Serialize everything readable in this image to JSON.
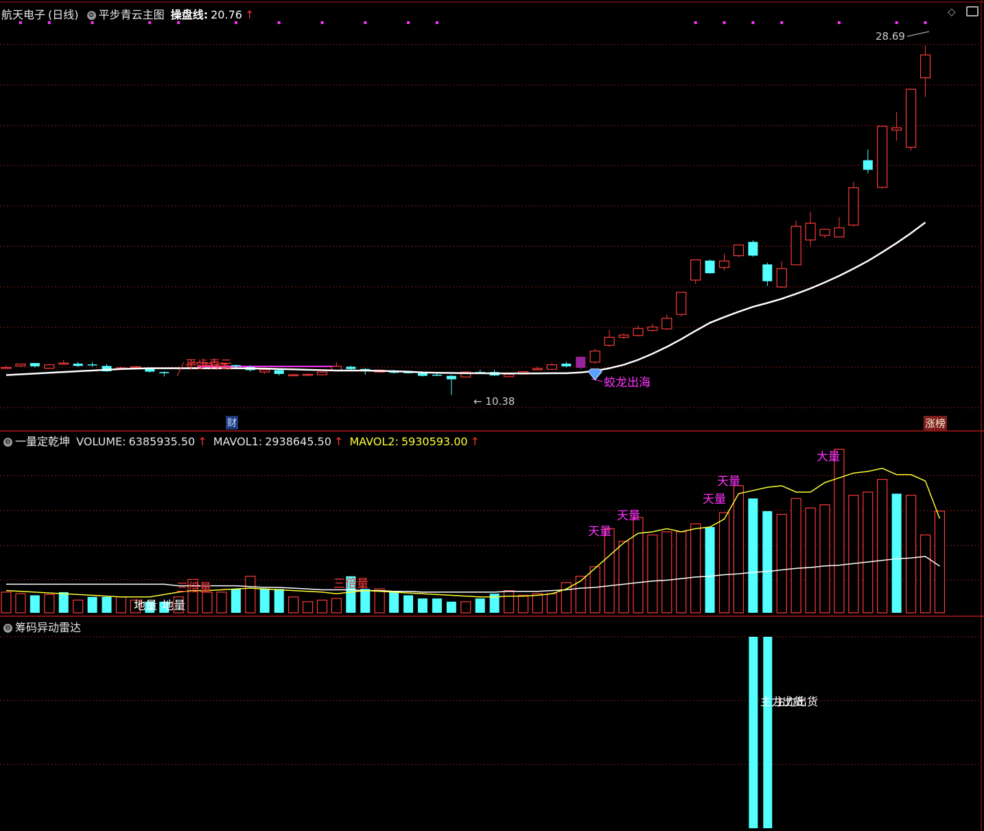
{
  "header": {
    "stock_name": "航天电子",
    "period": "(日线)",
    "main_indicator": "平步青云主图",
    "line_label": "操盘线:",
    "line_value": "20.76",
    "arrow": "↑"
  },
  "volume_header": {
    "name": "一量定乾坤",
    "volume_label": "VOLUME:",
    "volume_value": "6385935.50",
    "mavol1_label": "MAVOL1:",
    "mavol1_value": "2938645.50",
    "mavol2_label": "MAVOL2:",
    "mavol2_value": "5930593.00",
    "arrow": "↑"
  },
  "radar_header": {
    "name": "筹码异动雷达"
  },
  "badges": {
    "cai": "财",
    "zhangbang": "涨榜"
  },
  "icons": [
    "settings-icon",
    "diamond-icon",
    "window-icon"
  ],
  "colors": {
    "up": "#ff3b3b",
    "down": "#54ffff",
    "grid": "#8a1a1a",
    "magenta": "#ff33ff",
    "yellow": "#ffff33",
    "special": "#992299"
  },
  "chart_data": [
    {
      "type": "candlestick",
      "title": "平步青云主图",
      "annotations": [
        {
          "text": "平步青云",
          "color": "red",
          "x": 13
        },
        {
          "text": "蛟龙出海",
          "color": "magenta",
          "x": 41
        },
        {
          "text": "28.69",
          "x": 65
        },
        {
          "text": "10.38",
          "x": 32
        }
      ],
      "ylim": [
        9.5,
        30.0
      ],
      "ohlc": [
        [
          11.8,
          11.92,
          11.78,
          11.82
        ],
        [
          11.9,
          12.02,
          11.86,
          12.0
        ],
        [
          12.05,
          12.05,
          11.82,
          11.88
        ],
        [
          11.78,
          12.0,
          11.76,
          11.96
        ],
        [
          12.04,
          12.22,
          11.98,
          12.05
        ],
        [
          12.02,
          12.1,
          11.85,
          11.9
        ],
        [
          11.98,
          12.1,
          11.86,
          11.95
        ],
        [
          11.9,
          12.0,
          11.58,
          11.62
        ],
        [
          11.78,
          11.86,
          11.74,
          11.8
        ],
        [
          11.82,
          11.88,
          11.76,
          11.86
        ],
        [
          11.76,
          11.82,
          11.56,
          11.6
        ],
        [
          11.58,
          11.62,
          11.35,
          11.52
        ],
        [
          11.76,
          11.86,
          11.7,
          11.8
        ],
        [
          11.82,
          12.14,
          11.8,
          12.06
        ],
        [
          11.92,
          12.04,
          11.88,
          12.02
        ],
        [
          11.9,
          12.1,
          11.86,
          12.0
        ],
        [
          11.94,
          11.98,
          11.82,
          11.88
        ],
        [
          11.84,
          11.92,
          11.6,
          11.68
        ],
        [
          11.58,
          11.72,
          11.48,
          11.7
        ],
        [
          11.68,
          11.72,
          11.4,
          11.48
        ],
        [
          11.4,
          11.48,
          11.36,
          11.44
        ],
        [
          11.42,
          11.5,
          11.38,
          11.46
        ],
        [
          11.44,
          11.62,
          11.42,
          11.58
        ],
        [
          11.64,
          12.1,
          11.62,
          11.88
        ],
        [
          11.86,
          11.9,
          11.7,
          11.74
        ],
        [
          11.74,
          11.78,
          11.44,
          11.7
        ],
        [
          11.58,
          11.72,
          11.56,
          11.68
        ],
        [
          11.64,
          11.7,
          11.5,
          11.54
        ],
        [
          11.58,
          11.62,
          11.5,
          11.52
        ],
        [
          11.52,
          11.56,
          11.34,
          11.38
        ],
        [
          11.44,
          11.5,
          11.38,
          11.42
        ],
        [
          11.38,
          11.42,
          10.38,
          11.2
        ],
        [
          11.32,
          11.62,
          11.3,
          11.58
        ],
        [
          11.58,
          11.7,
          11.48,
          11.52
        ],
        [
          11.58,
          11.7,
          11.38,
          11.4
        ],
        [
          11.34,
          11.48,
          11.3,
          11.46
        ],
        [
          11.48,
          11.62,
          11.44,
          11.6
        ],
        [
          11.7,
          11.86,
          11.68,
          11.76
        ],
        [
          11.72,
          12.06,
          11.7,
          11.96
        ],
        [
          12.02,
          12.12,
          11.82,
          11.88
        ],
        [
          11.8,
          12.4,
          11.7,
          12.38
        ],
        [
          12.1,
          12.8,
          12.0,
          12.68
        ],
        [
          12.98,
          13.8,
          12.9,
          13.4
        ],
        [
          13.4,
          13.6,
          13.3,
          13.52
        ],
        [
          13.5,
          14.0,
          13.44,
          13.86
        ],
        [
          13.76,
          14.1,
          13.7,
          13.94
        ],
        [
          13.84,
          14.6,
          13.8,
          14.4
        ],
        [
          14.6,
          15.7,
          14.5,
          15.76
        ],
        [
          16.4,
          17.48,
          16.2,
          17.46
        ],
        [
          17.42,
          17.48,
          16.74,
          16.76
        ],
        [
          17.06,
          17.8,
          16.9,
          17.4
        ],
        [
          17.68,
          18.26,
          17.6,
          18.24
        ],
        [
          18.4,
          18.48,
          17.62,
          17.68
        ],
        [
          17.22,
          17.32,
          16.08,
          16.34
        ],
        [
          16.04,
          17.4,
          15.98,
          17.0
        ],
        [
          17.2,
          19.52,
          17.18,
          19.22
        ],
        [
          18.5,
          19.98,
          18.2,
          19.38
        ],
        [
          18.74,
          19.1,
          18.6,
          19.06
        ],
        [
          18.66,
          19.7,
          18.64,
          19.14
        ],
        [
          19.28,
          21.54,
          19.2,
          21.24
        ],
        [
          22.68,
          23.24,
          22.0,
          22.18
        ],
        [
          21.26,
          24.46,
          21.2,
          24.46
        ],
        [
          24.26,
          25.2,
          23.7,
          24.38
        ],
        [
          23.36,
          26.44,
          23.2,
          26.4
        ],
        [
          27.0,
          28.69,
          26.0,
          28.2
        ]
      ],
      "ma_line": [
        11.42,
        11.46,
        11.5,
        11.54,
        11.58,
        11.62,
        11.66,
        11.7,
        11.74,
        11.76,
        11.78,
        11.78,
        11.78,
        11.78,
        11.78,
        11.78,
        11.78,
        11.77,
        11.76,
        11.74,
        11.72,
        11.7,
        11.68,
        11.66,
        11.66,
        11.66,
        11.64,
        11.62,
        11.6,
        11.56,
        11.54,
        11.53,
        11.52,
        11.52,
        11.51,
        11.51,
        11.51,
        11.51,
        11.52,
        11.52,
        11.56,
        11.64,
        11.78,
        11.96,
        12.22,
        12.54,
        12.9,
        13.3,
        13.74,
        14.16,
        14.46,
        14.74,
        15.0,
        15.2,
        15.42,
        15.68,
        15.96,
        16.28,
        16.62,
        17.0,
        17.4,
        17.86,
        18.34,
        18.86,
        19.42
      ]
    },
    {
      "type": "bar",
      "title": "一量定乾坤",
      "series_labels": [
        "VOLUME",
        "MAVOL1",
        "MAVOL2"
      ],
      "labels": [
        {
          "text": "地量",
          "x": 10
        },
        {
          "text": "地量",
          "x": 11
        },
        {
          "text": "三倍量",
          "x": 13
        },
        {
          "text": "三倍量",
          "x": 24
        },
        {
          "text": "天量",
          "x": 42
        },
        {
          "text": "天量",
          "x": 44
        },
        {
          "text": "天量",
          "x": 50
        },
        {
          "text": "天量",
          "x": 51
        },
        {
          "text": "大量",
          "x": 58
        }
      ],
      "ylim": [
        0,
        10500000
      ],
      "volume": [
        1300000,
        1200000,
        1100000,
        1150000,
        1300000,
        800000,
        1000000,
        1000000,
        1000000,
        800000,
        700000,
        700000,
        1000000,
        2100000,
        1300000,
        1300000,
        1500000,
        2300000,
        1500000,
        1500000,
        1000000,
        700000,
        800000,
        900000,
        2300000,
        1500000,
        1500000,
        1300000,
        1100000,
        900000,
        900000,
        700000,
        700000,
        900000,
        1200000,
        1400000,
        1100000,
        1200000,
        1200000,
        1900000,
        2300000,
        2900000,
        5300000,
        4500000,
        6000000,
        4900000,
        5100000,
        5100000,
        5600000,
        5400000,
        6300000,
        8000000,
        7200000,
        6400000,
        6200000,
        7200000,
        6600000,
        6800000,
        10300000,
        7400000,
        7600000,
        8400000,
        7500000,
        7400000,
        4900000,
        6400000
      ],
      "up": [
        true,
        true,
        false,
        true,
        false,
        true,
        false,
        false,
        true,
        true,
        false,
        false,
        true,
        true,
        true,
        true,
        false,
        true,
        false,
        false,
        true,
        true,
        true,
        true,
        false,
        false,
        true,
        false,
        false,
        false,
        false,
        false,
        true,
        false,
        false,
        true,
        true,
        true,
        true,
        true,
        true,
        true,
        true,
        true,
        true,
        true,
        true,
        true,
        true,
        false,
        true,
        true,
        false,
        false,
        true,
        true,
        true,
        true,
        true,
        true,
        true,
        true,
        false,
        true,
        true,
        true
      ],
      "mavol1": [
        1800000,
        1800000,
        1800000,
        1800000,
        1800000,
        1800000,
        1800000,
        1800000,
        1800000,
        1800000,
        1800000,
        1800000,
        1700000,
        1700000,
        1700000,
        1700000,
        1700000,
        1650000,
        1600000,
        1600000,
        1550000,
        1500000,
        1450000,
        1450000,
        1450000,
        1400000,
        1400000,
        1350000,
        1350000,
        1300000,
        1300000,
        1300000,
        1300000,
        1300000,
        1300000,
        1350000,
        1350000,
        1350000,
        1400000,
        1450000,
        1550000,
        1600000,
        1700000,
        1800000,
        1900000,
        2000000,
        2050000,
        2150000,
        2250000,
        2300000,
        2400000,
        2450000,
        2550000,
        2600000,
        2700000,
        2800000,
        2850000,
        2950000,
        3000000,
        3100000,
        3200000,
        3300000,
        3400000,
        3450000,
        3550000,
        2938645
      ],
      "mavol2": [
        1400000,
        1350000,
        1300000,
        1250000,
        1200000,
        1150000,
        1100000,
        1050000,
        1000000,
        1000000,
        1000000,
        1150000,
        1300000,
        1400000,
        1400000,
        1450000,
        1500000,
        1550000,
        1500000,
        1450000,
        1400000,
        1350000,
        1300000,
        1200000,
        1300000,
        1400000,
        1350000,
        1300000,
        1250000,
        1200000,
        1150000,
        1100000,
        1050000,
        1000000,
        1000000,
        1050000,
        1050000,
        1100000,
        1200000,
        1500000,
        2000000,
        2800000,
        3600000,
        4400000,
        5000000,
        5100000,
        5300000,
        5100000,
        5300000,
        5400000,
        5900000,
        7500000,
        7700000,
        7900000,
        8000000,
        7600000,
        7600000,
        8200000,
        8500000,
        8800000,
        8900000,
        9100000,
        8700000,
        8700000,
        8300000,
        5930593
      ]
    },
    {
      "type": "bar",
      "title": "筹码异动雷达",
      "labels": [
        {
          "text": "主力出货",
          "x": 52
        },
        {
          "text": "主力出货",
          "x": 53
        }
      ],
      "values": [
        {
          "x": 52,
          "value": 1.0
        },
        {
          "x": 53,
          "value": 1.0
        }
      ],
      "ylim": [
        0,
        1.0
      ]
    }
  ]
}
